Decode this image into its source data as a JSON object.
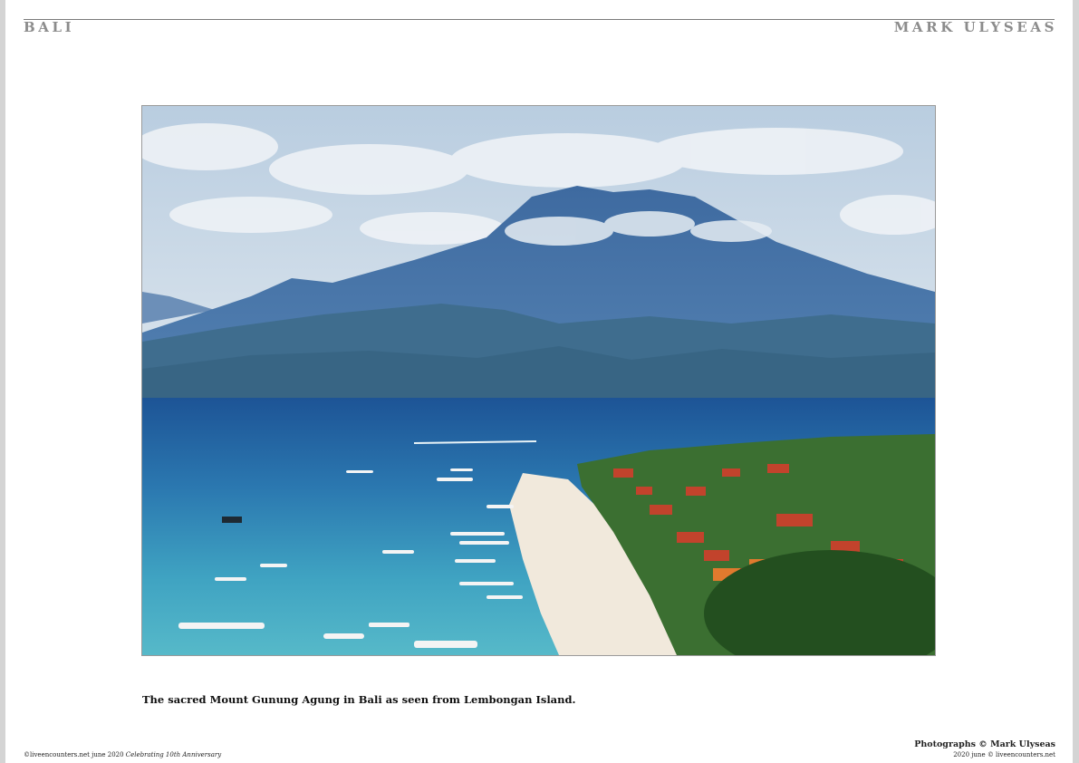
{
  "header": {
    "left_title": "BALI",
    "right_author": "MARK ULYSEAS"
  },
  "photo": {
    "caption": "The sacred Mount Gunung Agung in Bali as seen from Lembongan Island."
  },
  "footer": {
    "left_text": "©liveencounters.net june 2020 ",
    "left_italic": "Celebrating 10th Anniversary",
    "credit": "Photographs © Mark Ulyseas",
    "right_text": "2020 june © liveencounters.net"
  },
  "colors": {
    "header_text": "#8c8c8c",
    "sky": "#cfdce8",
    "mountain": "#4a76a8",
    "sea_deep": "#1f5e9e",
    "sea_shallow": "#4fb0c6",
    "sand": "#f3ece0",
    "roofs": "#c2432c",
    "foliage": "#2f6a2a"
  }
}
